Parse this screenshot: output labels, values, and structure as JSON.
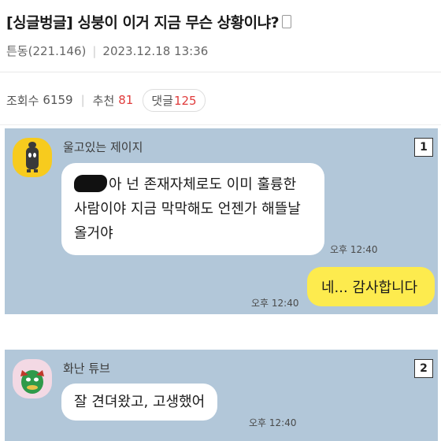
{
  "post": {
    "title": "[싱글벙글] 싱붕이 이거 지금 무슨 상황이냐?",
    "author": "튼동(221.146)",
    "date": "2023.12.18 13:36",
    "views_label": "조회수",
    "views": "6159",
    "likes_label": "추천",
    "likes": "81",
    "comments_label": "댓글",
    "comments": "125"
  },
  "chat1": {
    "index": "1",
    "sender": "울고있는 제이지",
    "message": "아 넌 존재자체로도 이미 훌륭한 사람이야 지금 막막해도 언젠가 해뜰날 올거야",
    "message_time": "오후 12:40",
    "reply": "네... 감사합니다",
    "reply_time": "오후 12:40"
  },
  "chat2": {
    "index": "2",
    "sender": "화난 튜브",
    "message": "잘 견뎌왔고, 고생했어",
    "message_time": "오후 12:40"
  },
  "colors": {
    "chat_background": "#b2c7d9",
    "outgoing_bubble": "#fdeb4e",
    "accent_red": "#e03c3c"
  }
}
